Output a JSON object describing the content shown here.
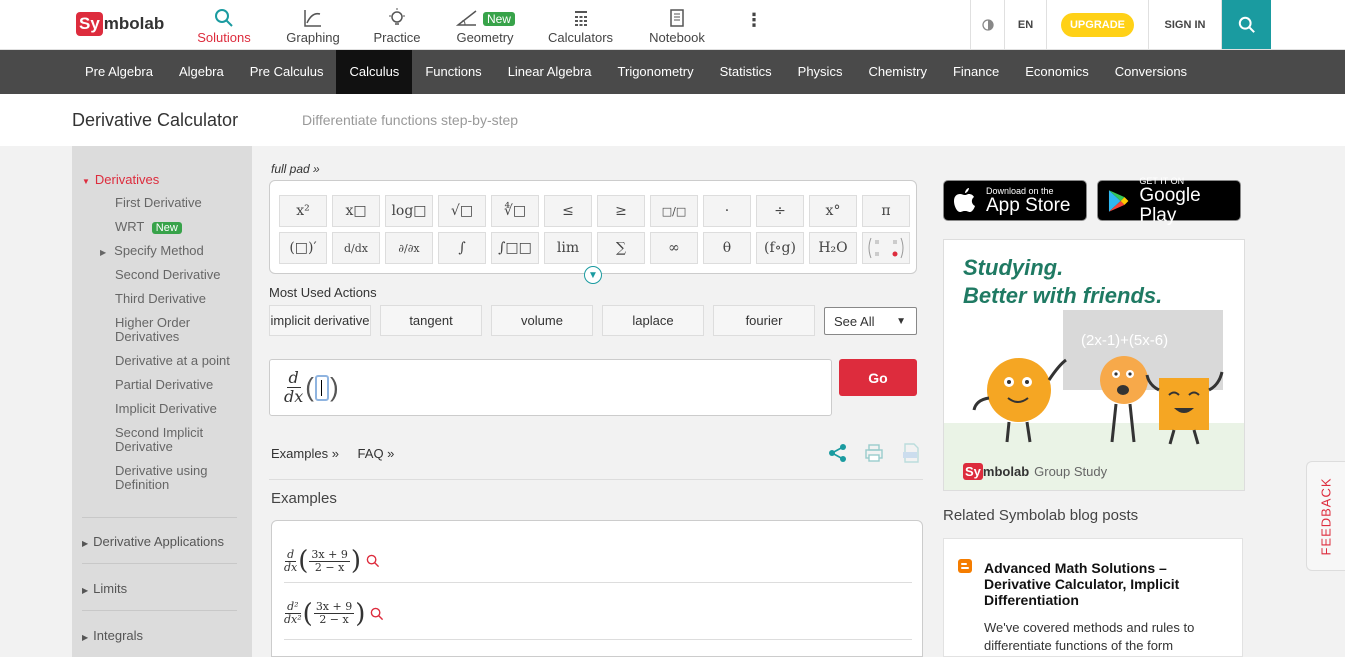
{
  "brand": {
    "logo_left": "Sy",
    "logo_right": "mbolab"
  },
  "topnav": {
    "items": [
      {
        "label": "Solutions",
        "icon": "search-icon"
      },
      {
        "label": "Graphing",
        "icon": "graph-icon"
      },
      {
        "label": "Practice",
        "icon": "lightbulb-icon"
      },
      {
        "label": "Geometry",
        "icon": "angle-icon",
        "badge": "New"
      },
      {
        "label": "Calculators",
        "icon": "calculator-icon"
      },
      {
        "label": "Notebook",
        "icon": "notebook-icon"
      }
    ],
    "more": "⋮",
    "lang": "EN",
    "upgrade": "UPGRADE",
    "signin": "SIGN IN"
  },
  "subjects": [
    "Pre Algebra",
    "Algebra",
    "Pre Calculus",
    "Calculus",
    "Functions",
    "Linear Algebra",
    "Trigonometry",
    "Statistics",
    "Physics",
    "Chemistry",
    "Finance",
    "Economics",
    "Conversions"
  ],
  "page": {
    "title": "Derivative Calculator",
    "subtitle": "Differentiate functions step-by-step"
  },
  "sidebar": {
    "section": "Derivatives",
    "items": [
      "First Derivative",
      "WRT",
      "Specify Method",
      "Second Derivative",
      "Third Derivative",
      "Higher Order Derivatives",
      "Derivative at a point",
      "Partial Derivative",
      "Implicit Derivative",
      "Second Implicit Derivative",
      "Derivative using Definition"
    ],
    "wrt_badge": "New",
    "groups": [
      "Derivative Applications",
      "Limits",
      "Integrals"
    ]
  },
  "keypad": {
    "fullpad": "full pad »",
    "row1": [
      "x²",
      "x□",
      "log□",
      "√□",
      "∜□",
      "≤",
      "≥",
      "□/□",
      "·",
      "÷",
      "x°",
      "π"
    ],
    "row2": [
      "(□)′",
      "d/dx",
      "∂/∂x",
      "∫",
      "∫□□",
      "lim",
      "∑",
      "∞",
      "θ",
      "(f∘g)",
      "H₂O",
      "matrix"
    ]
  },
  "actions": {
    "label": "Most Used Actions",
    "buttons": [
      "implicit derivative",
      "tangent",
      "volume",
      "laplace",
      "fourier"
    ],
    "see_all": "See All"
  },
  "input": {
    "expr_num": "d",
    "expr_den": "dx",
    "go": "Go"
  },
  "links": {
    "examples": "Examples »",
    "faq": "FAQ »"
  },
  "examples": {
    "title": "Examples",
    "rows": [
      {
        "prefix_num": "d",
        "prefix_den": "dx",
        "num": "3x + 9",
        "den": "2 − x"
      },
      {
        "prefix_num": "d²",
        "prefix_den": "dx²",
        "num": "3x + 9",
        "den": "2 − x"
      }
    ]
  },
  "stores": {
    "apple_small": "Download on the",
    "apple_big": "App Store",
    "google_small": "GET IT ON",
    "google_big": "Google Play"
  },
  "ad": {
    "headline1": "Studying.",
    "headline2": "Better with friends.",
    "formula": "(2x-1)+(5x-6)",
    "brand": "Group Study"
  },
  "related": {
    "title": "Related Symbolab blog posts",
    "post_title": "Advanced Math Solutions – Derivative Calculator, Implicit Differentiation",
    "post_body": "We've covered methods and rules to differentiate functions of the form"
  },
  "feedback": "FEEDBACK",
  "colors": {
    "brand_red": "#dd2c3d",
    "teal": "#1a9ba0",
    "upgrade_yellow": "#ffd117",
    "new_green": "#38a34a"
  }
}
